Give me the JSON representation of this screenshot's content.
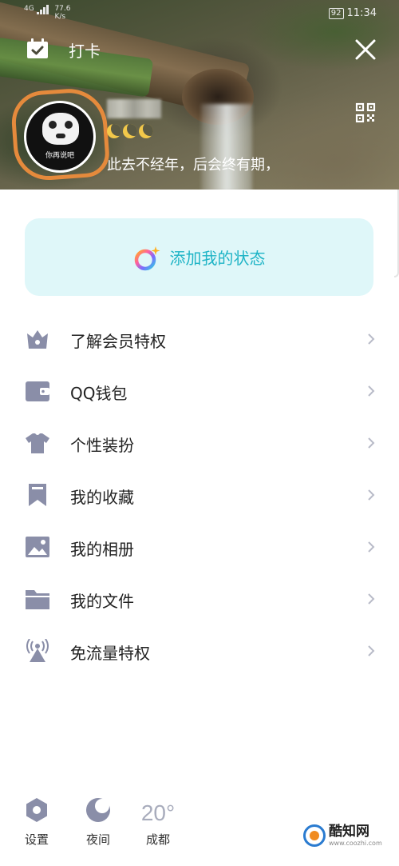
{
  "status_bar": {
    "network": "4G",
    "speed": "77.6",
    "speed_unit": "K/s",
    "battery": "92",
    "time": "11:34"
  },
  "header": {
    "checkin_label": "打卡",
    "avatar_caption": "你再说吧",
    "signature": "此去不经年，后会终有期，",
    "moon_count": 3
  },
  "status_card": {
    "label": "添加我的状态"
  },
  "menu": {
    "items": [
      {
        "label": "了解会员特权",
        "icon": "crown-icon"
      },
      {
        "label": "QQ钱包",
        "icon": "wallet-icon"
      },
      {
        "label": "个性装扮",
        "icon": "tshirt-icon"
      },
      {
        "label": "我的收藏",
        "icon": "bookmark-icon"
      },
      {
        "label": "我的相册",
        "icon": "photo-icon"
      },
      {
        "label": "我的文件",
        "icon": "folder-icon"
      },
      {
        "label": "免流量特权",
        "icon": "signal-tower-icon"
      }
    ]
  },
  "bottom_bar": {
    "settings_label": "设置",
    "night_label": "夜间",
    "temperature": "20°",
    "city": "成都"
  },
  "watermark": {
    "name": "酷知网",
    "url": "www.coozhi.com"
  },
  "colors": {
    "accent": "#1fb4c6",
    "card_bg": "#dff7f9",
    "icon_gray": "#8a8ea8",
    "avatar_ring": "#e58a3c"
  }
}
